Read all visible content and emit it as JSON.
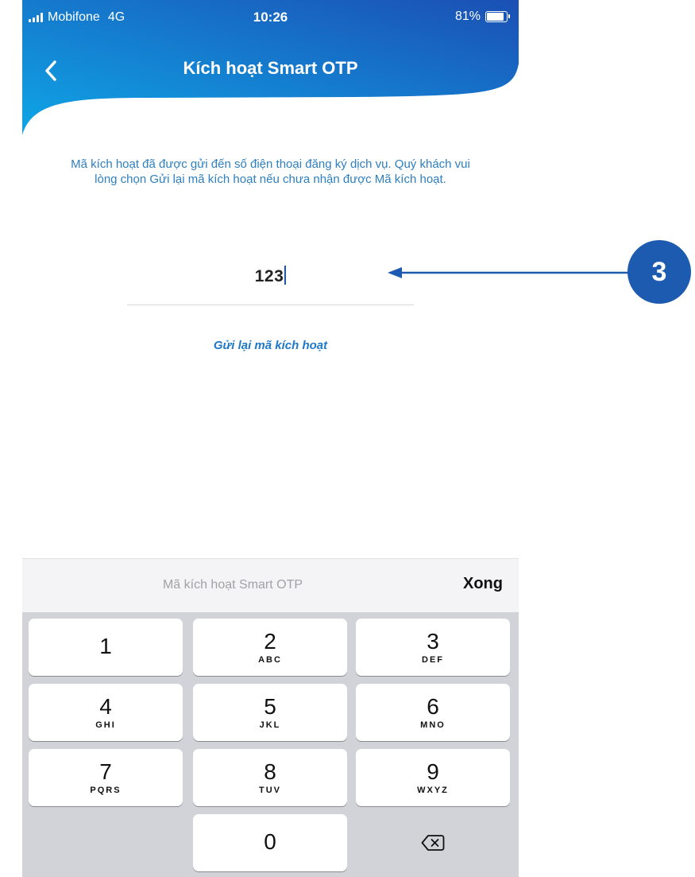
{
  "status_bar": {
    "carrier": "Mobifone",
    "network": "4G",
    "time": "10:26",
    "battery_percent": "81%",
    "battery_level": 0.81
  },
  "header": {
    "title": "Kích hoạt Smart OTP",
    "back_icon": "chevron-left-icon",
    "gradient": [
      "#0fa6e6",
      "#1b4fb4"
    ]
  },
  "message": "Mã kích hoạt đã được gửi đến số điện thoại đăng ký dịch vụ. Quý khách vui lòng chọn Gửi lại mã kích hoạt nếu chưa nhận được Mã kích hoạt.",
  "code_input": {
    "value": "123"
  },
  "resend_link": "Gửi lại mã kích hoạt",
  "keyboard": {
    "toolbar_placeholder": "Mã kích hoạt Smart OTP",
    "done_label": "Xong",
    "keys": [
      {
        "num": "1",
        "letters": ""
      },
      {
        "num": "2",
        "letters": "ABC"
      },
      {
        "num": "3",
        "letters": "DEF"
      },
      {
        "num": "4",
        "letters": "GHI"
      },
      {
        "num": "5",
        "letters": "JKL"
      },
      {
        "num": "6",
        "letters": "MNO"
      },
      {
        "num": "7",
        "letters": "PQRS"
      },
      {
        "num": "8",
        "letters": "TUV"
      },
      {
        "num": "9",
        "letters": "WXYZ"
      },
      {
        "num": "0",
        "letters": ""
      }
    ],
    "delete_icon": "backspace-icon"
  },
  "annotation": {
    "step_number": "3",
    "color": "#1d5bb0"
  }
}
